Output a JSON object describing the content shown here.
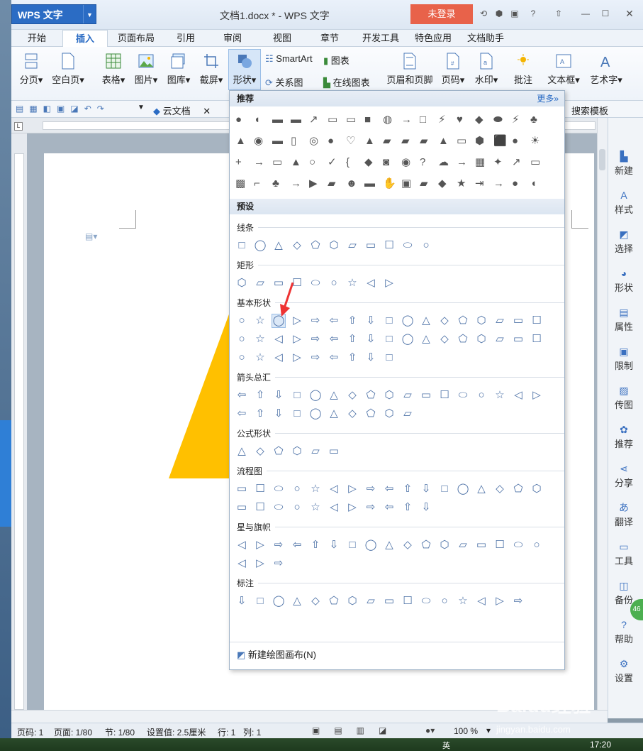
{
  "app": {
    "logo": "WPS 文字",
    "doc_title": "文档1.docx * - WPS 文字",
    "login": "未登录"
  },
  "menu": [
    "开始",
    "插入",
    "页面布局",
    "引用",
    "审阅",
    "视图",
    "章节",
    "开发工具",
    "特色应用",
    "文档助手"
  ],
  "ribbon": {
    "fenye": "分页",
    "kongbaiye": "空白页",
    "biaoge": "表格",
    "tupian": "图片",
    "tuku": "图库",
    "jieping": "截屏",
    "xingzhuang": "形状",
    "smartart": "SmartArt",
    "tubiao": "图表",
    "guanxitu": "关系图",
    "zaixian": "在线图表",
    "yemei": "页眉和页脚",
    "yema": "页码",
    "shuiyin": "水印",
    "pizhu": "批注",
    "wenbenkuang": "文本框",
    "yishuzi": "艺术字"
  },
  "quick": {
    "cloud": "云文档",
    "search_hint": "找命令、搜索模板"
  },
  "dropdown": {
    "recommend": "推荐",
    "more": "更多»",
    "preset": "预设",
    "cats": [
      "线条",
      "矩形",
      "基本形状",
      "箭头总汇",
      "公式形状",
      "流程图",
      "星与旗帜",
      "标注"
    ],
    "new_canvas": "新建绘图画布(N)"
  },
  "sidebar": [
    "新建",
    "样式",
    "选择",
    "形状",
    "属性",
    "限制",
    "传图",
    "推荐",
    "分享",
    "翻译",
    "工具",
    "备份",
    "帮助",
    "设置"
  ],
  "status": {
    "page_no": "页码: 1",
    "pages": "页面: 1/80",
    "section": "节: 1/80",
    "setting": "设置值: 2.5厘米",
    "row": "行: 1",
    "col": "列: 1",
    "zoom": "100 %"
  },
  "taskbar": {
    "time": "17:20",
    "ime": "英"
  },
  "watermark": {
    "text": "Baidu经验",
    "url": "jingyan.baidu.com"
  },
  "badge": "46",
  "colors": {
    "accent": "#2b6cc4",
    "shape_fill": "#FFC000",
    "login": "#e8624a"
  }
}
